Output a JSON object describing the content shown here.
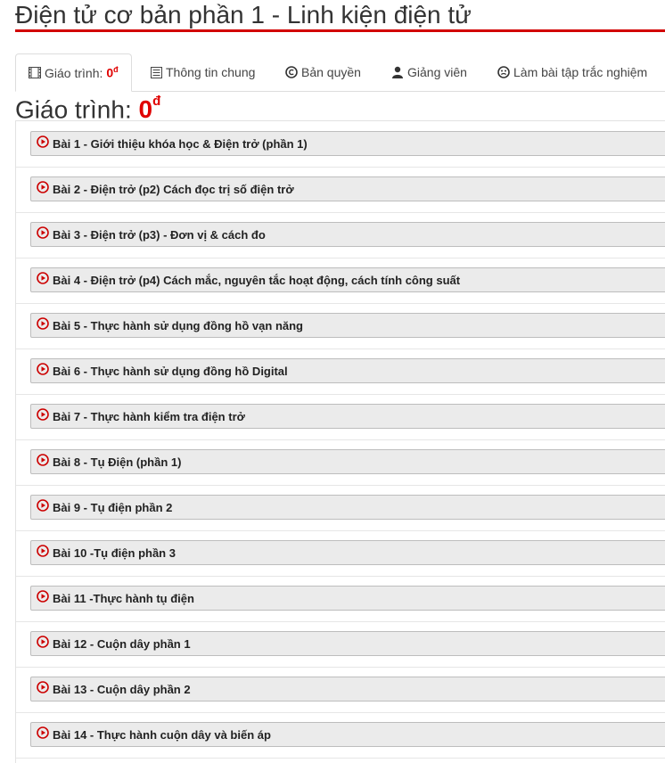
{
  "course": {
    "title": "Điện tử cơ bản phần 1 - Linh kiện điện tử"
  },
  "tabs": [
    {
      "label": "Giáo trình: ",
      "price": "0",
      "currency": "đ",
      "icon": "film-icon",
      "active": true
    },
    {
      "label": "Thông tin chung",
      "icon": "list-icon"
    },
    {
      "label": "Bản quyền",
      "icon": "copyright-icon"
    },
    {
      "label": "Giảng viên",
      "icon": "user-icon"
    },
    {
      "label": "Làm bài tập trắc nghiệm",
      "icon": "quiz-icon"
    }
  ],
  "section": {
    "label": "Giáo trình: ",
    "price": "0",
    "currency": "đ"
  },
  "lessons": [
    "Bài 1 - Giới thiệu khóa học & Điện trở (phần 1)",
    "Bài 2 - Điện trở (p2) Cách đọc trị số điện trở",
    "Bài 3 - Điện trở (p3) - Đơn vị & cách đo",
    "Bài 4 - Điện trở (p4) Cách mắc, nguyên tắc hoạt động, cách tính công suất",
    "Bài 5 - Thực hành sử dụng đồng hồ vạn năng",
    "Bài 6 - Thực hành sử dụng đồng hồ Digital",
    "Bài 7 - Thực hành kiểm tra điện trở",
    "Bài 8 - Tụ Điện (phần 1)",
    "Bài 9 - Tụ điện phần 2",
    "Bài 10 -Tụ điện phần 3",
    "Bài 11 -Thực hành tụ điện",
    "Bài 12 - Cuộn dây phần 1",
    "Bài 13 - Cuộn dây phần 2",
    "Bài 14 - Thực hành cuộn dây và biến áp"
  ],
  "colors": {
    "accent": "#d20000",
    "price": "#e00000",
    "lesson_bg": "#ebebeb",
    "play_icon": "#cc0000"
  }
}
